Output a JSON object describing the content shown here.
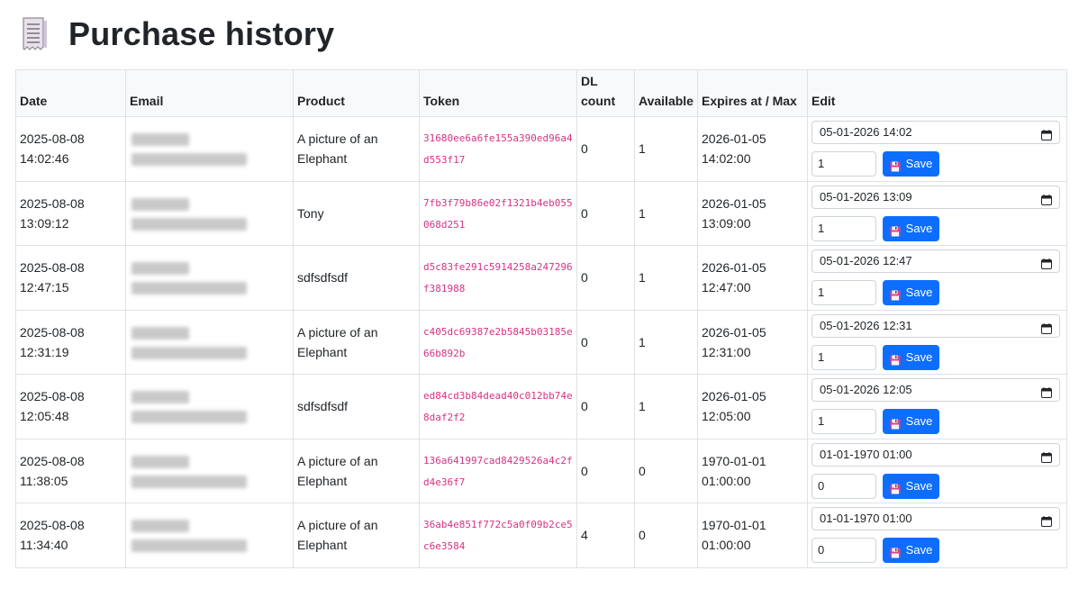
{
  "page": {
    "title": "Purchase history"
  },
  "table": {
    "headers": {
      "date": "Date",
      "email": "Email",
      "product": "Product",
      "token": "Token",
      "dl_count_1": "DL",
      "dl_count_2": "count",
      "available": "Available",
      "expires": "Expires at / Max",
      "edit": "Edit"
    },
    "rows": [
      {
        "date": "2025-08-08",
        "time": "14:02:46",
        "product": "A picture of an Elephant",
        "token": "31680ee6a6fe155a390ed96a4d553f17",
        "dl_count": "0",
        "available": "1",
        "expires_date": "2026-01-05",
        "expires_time": "14:02:00",
        "edit_datetime": "05-01-2026 14:02",
        "edit_max": "1",
        "save_label": "Save"
      },
      {
        "date": "2025-08-08",
        "time": "13:09:12",
        "product": "Tony",
        "token": "7fb3f79b86e02f1321b4eb055068d251",
        "dl_count": "0",
        "available": "1",
        "expires_date": "2026-01-05",
        "expires_time": "13:09:00",
        "edit_datetime": "05-01-2026 13:09",
        "edit_max": "1",
        "save_label": "Save"
      },
      {
        "date": "2025-08-08",
        "time": "12:47:15",
        "product": "sdfsdfsdf",
        "token": "d5c83fe291c5914258a247296f381988",
        "dl_count": "0",
        "available": "1",
        "expires_date": "2026-01-05",
        "expires_time": "12:47:00",
        "edit_datetime": "05-01-2026 12:47",
        "edit_max": "1",
        "save_label": "Save"
      },
      {
        "date": "2025-08-08",
        "time": "12:31:19",
        "product": "A picture of an Elephant",
        "token": "c405dc69387e2b5845b03185e66b892b",
        "dl_count": "0",
        "available": "1",
        "expires_date": "2026-01-05",
        "expires_time": "12:31:00",
        "edit_datetime": "05-01-2026 12:31",
        "edit_max": "1",
        "save_label": "Save"
      },
      {
        "date": "2025-08-08",
        "time": "12:05:48",
        "product": "sdfsdfsdf",
        "token": "ed84cd3b84dead40c012bb74e8daf2f2",
        "dl_count": "0",
        "available": "1",
        "expires_date": "2026-01-05",
        "expires_time": "12:05:00",
        "edit_datetime": "05-01-2026 12:05",
        "edit_max": "1",
        "save_label": "Save"
      },
      {
        "date": "2025-08-08",
        "time": "11:38:05",
        "product": "A picture of an Elephant",
        "token": "136a641997cad8429526a4c2fd4e36f7",
        "dl_count": "0",
        "available": "0",
        "expires_date": "1970-01-01",
        "expires_time": "01:00:00",
        "edit_datetime": "01-01-1970 01:00",
        "edit_max": "0",
        "save_label": "Save"
      },
      {
        "date": "2025-08-08",
        "time": "11:34:40",
        "product": "A picture of an Elephant",
        "token": "36ab4e851f772c5a0f09b2ce5c6e3584",
        "dl_count": "4",
        "available": "0",
        "expires_date": "1970-01-01",
        "expires_time": "01:00:00",
        "edit_datetime": "01-01-1970 01:00",
        "edit_max": "0",
        "save_label": "Save"
      }
    ]
  },
  "colors": {
    "primary": "#0d6efd",
    "token_text": "#d63384",
    "header_bg": "#f8f9fa",
    "border": "#dee2e6"
  },
  "icons": {
    "title": "receipt-icon",
    "date_picker": "calendar-icon",
    "save": "floppy-disk-icon"
  }
}
